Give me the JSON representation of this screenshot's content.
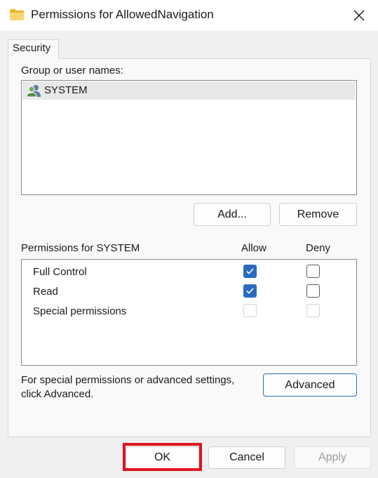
{
  "window": {
    "title": "Permissions for AllowedNavigation"
  },
  "tabs": [
    {
      "label": "Security"
    }
  ],
  "group_section": {
    "label": "Group or user names:",
    "users": [
      {
        "name": "SYSTEM",
        "icon": "users-icon"
      }
    ],
    "add_label": "Add...",
    "remove_label": "Remove"
  },
  "permissions": {
    "header_label": "Permissions for SYSTEM",
    "allow_header": "Allow",
    "deny_header": "Deny",
    "rows": [
      {
        "name": "Full Control",
        "allow": true,
        "deny": false,
        "enabled": true
      },
      {
        "name": "Read",
        "allow": true,
        "deny": false,
        "enabled": true
      },
      {
        "name": "Special permissions",
        "allow": false,
        "deny": false,
        "enabled": false
      }
    ]
  },
  "advanced": {
    "text_line1": "For special permissions or advanced settings,",
    "text_line2": "click Advanced.",
    "button_label": "Advanced"
  },
  "footer": {
    "ok_label": "OK",
    "cancel_label": "Cancel",
    "apply_label": "Apply"
  },
  "colors": {
    "accent": "#2b6bbf",
    "highlight": "#e0141e",
    "folder": "#f4c542"
  }
}
